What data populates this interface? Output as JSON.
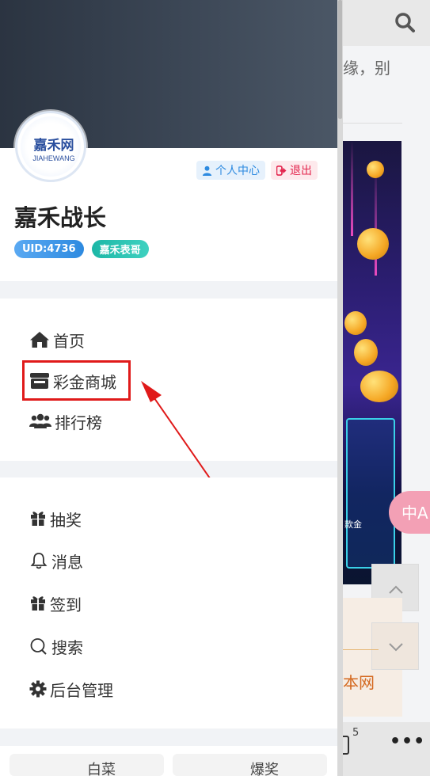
{
  "background": {
    "partial_text": "缘，别",
    "banner_label": "款金",
    "orange_text": "本网",
    "translate_label": "中A",
    "bottom_badge": "5",
    "more_label": "•••"
  },
  "drawer": {
    "avatar": {
      "cn": "嘉禾网",
      "en": "JIAHEWANG"
    },
    "personal_center_label": "个人中心",
    "logout_label": "退出",
    "username": "嘉禾战长",
    "uid_tag": "UID:4736",
    "group_tag": "嘉禾表哥",
    "nav_main": [
      {
        "label": "首页",
        "icon": "home-icon"
      },
      {
        "label": "彩金商城",
        "icon": "store-icon"
      },
      {
        "label": "排行榜",
        "icon": "users-icon"
      }
    ],
    "nav_tools": [
      {
        "label": "抽奖",
        "icon": "gift-icon"
      },
      {
        "label": "消息",
        "icon": "bell-icon"
      },
      {
        "label": "签到",
        "icon": "gift-icon"
      },
      {
        "label": "搜索",
        "icon": "search-icon"
      },
      {
        "label": "后台管理",
        "icon": "gear-icon"
      }
    ],
    "bottom_partial": [
      "白菜",
      "爆奖"
    ]
  },
  "colors": {
    "accent_blue": "#2d8ae0",
    "logout_red": "#e3264e",
    "annotation_red": "#e01a1a"
  }
}
